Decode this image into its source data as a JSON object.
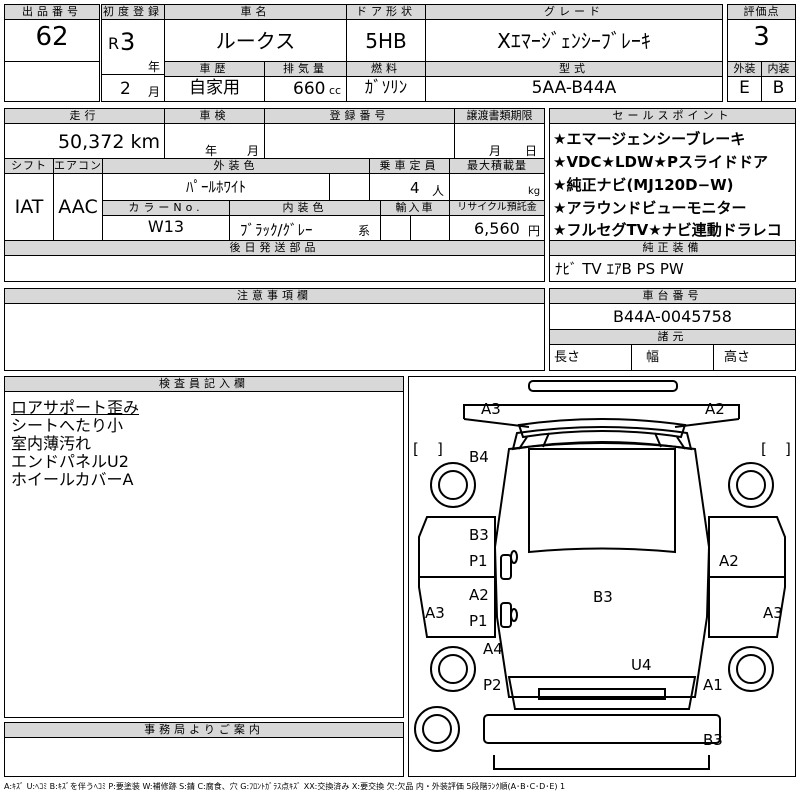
{
  "header": {
    "lot_no_label": "出品番号",
    "lot_no": "62",
    "first_reg_label": "初度登録",
    "era": "R",
    "year_num": "3",
    "year_unit": "年",
    "month_num": "2",
    "month_unit": "月",
    "car_name_label": "車名",
    "car_name": "ルークス",
    "door_label": "ドア形状",
    "door": "5HB",
    "grade_label": "グレード",
    "grade": "Xｴﾏｰｼﾞｪﾝｼｰﾌﾞﾚｰｷ",
    "score_label": "評価点",
    "score": "3",
    "history_label": "車歴",
    "history": "自家用",
    "displacement_label": "排気量",
    "displacement": "660",
    "displacement_unit": "cc",
    "fuel_label": "燃料",
    "fuel": "ｶﾞｿﾘﾝ",
    "model_label": "型式",
    "model": "5AA-B44A",
    "exterior_label": "外装",
    "exterior": "E",
    "interior_label": "内装",
    "interior": "B"
  },
  "row2": {
    "mileage_label": "走行",
    "mileage": "50,372 km",
    "inspection_label": "車検",
    "insp_year": "年",
    "insp_month": "月",
    "reg_no_label": "登録番号",
    "transfer_label": "譲渡書類期限",
    "transfer_month": "月",
    "transfer_day": "日",
    "shift_label": "シフト",
    "shift": "IAT",
    "ac_label": "エアコン",
    "ac": "AAC",
    "ext_color_label": "外装色",
    "ext_color": "ﾊﾟｰﾙﾎﾜｲﾄ",
    "capacity_label": "乗車定員",
    "capacity": "4",
    "capacity_unit": "人",
    "max_load_label": "最大積載量",
    "max_load_unit": "kg",
    "color_no_label": "カラーNo.",
    "color_no": "W13",
    "int_color_label": "内装色",
    "int_color": "ﾌﾞﾗｯｸ/ｸﾞﾚｰ",
    "int_color_suffix": "系",
    "import_label": "輸入車",
    "recycle_label": "リサイクル預託金",
    "recycle": "6,560",
    "recycle_unit": "円",
    "later_parts_label": "後日発送部品"
  },
  "sales": {
    "label": "セールスポイント",
    "items": [
      "★エマージェンシーブレーキ",
      "★VDC★LDW★Pスライドドア",
      "★純正ナビ(MJ120D−W)",
      "★アラウンドビューモニター",
      "★フルセグTV★ナビ連動ドラレコ"
    ],
    "equip_label": "純正装備",
    "equip": "ﾅﾋﾞ TV ｴｱB PS PW"
  },
  "notes": {
    "label": "注意事項欄"
  },
  "chassis": {
    "label": "車台番号",
    "number": "B44A-0045758",
    "dims_label": "諸元",
    "length": "長さ",
    "width": "幅",
    "height": "高さ"
  },
  "inspector": {
    "label": "検査員記入欄",
    "lines": [
      "ロアサポート歪み",
      "シートへたり小",
      "室内薄汚れ",
      "エンドパネルU2",
      "ホイールカバーA"
    ]
  },
  "office": {
    "label": "事務局よりご案内"
  },
  "diagram": {
    "marks": [
      "A3",
      "A2",
      "B4",
      "B3",
      "P1",
      "A2",
      "A2",
      "P1",
      "B3",
      "A3",
      "A3",
      "A4",
      "U4",
      "P2",
      "A1",
      "B3"
    ],
    "brackets": [
      "[",
      "]",
      "[",
      "]"
    ]
  },
  "legend": "A:ｷｽﾞ U:ﾍｺﾐ B:ｷｽﾞを伴うﾍｺﾐ P:要塗装 W:補修跡 S:錆 C:腐食、穴 G:ﾌﾛﾝﾄｶﾞﾗｽ点ｷｽﾞ XX:交換済み X:要交換 欠:欠品 内・外装評価 5段階ﾗﾝｸ順(A･B･C･D･E) 1"
}
